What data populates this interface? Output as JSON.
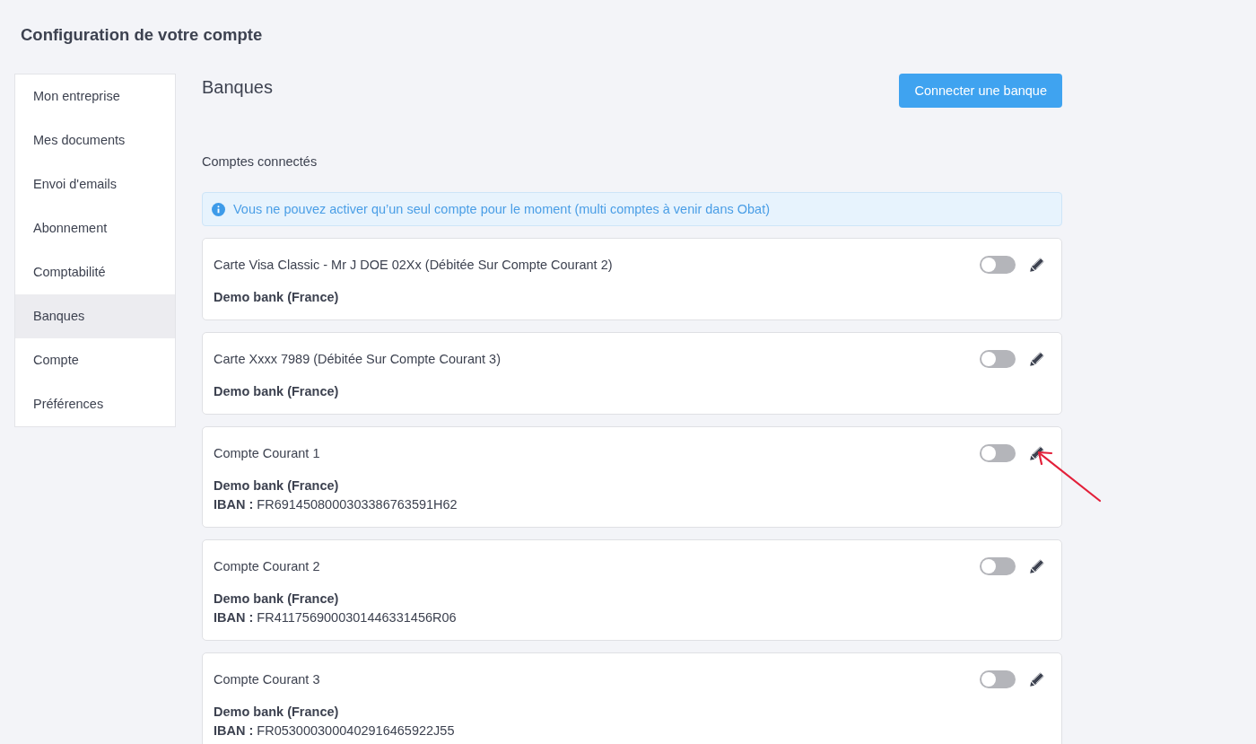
{
  "page_title": "Configuration de votre compte",
  "sidebar": {
    "items": [
      {
        "label": "Mon entreprise",
        "selected": false
      },
      {
        "label": "Mes documents",
        "selected": false
      },
      {
        "label": "Envoi d'emails",
        "selected": false
      },
      {
        "label": "Abonnement",
        "selected": false
      },
      {
        "label": "Comptabilité",
        "selected": false
      },
      {
        "label": "Banques",
        "selected": true
      },
      {
        "label": "Compte",
        "selected": false
      },
      {
        "label": "Préférences",
        "selected": false
      }
    ]
  },
  "section": {
    "title": "Banques",
    "connect_button": "Connecter une banque",
    "subtitle": "Comptes connectés",
    "info": "Vous ne pouvez activer qu’un seul compte pour le moment (multi comptes à venir dans Obat)"
  },
  "accounts": [
    {
      "name": "Carte Visa Classic - Mr J DOE 02Xx (Débitée Sur Compte Courant 2)",
      "bank": "Demo bank (France)",
      "enabled": false
    },
    {
      "name": "Carte Xxxx 7989 (Débitée Sur Compte Courant 3)",
      "bank": "Demo bank (France)",
      "enabled": false
    },
    {
      "name": "Compte Courant 1",
      "bank": "Demo bank (France)",
      "iban_label": "IBAN :",
      "iban": "FR6914508000303386763591H62",
      "enabled": false
    },
    {
      "name": "Compte Courant 2",
      "bank": "Demo bank (France)",
      "iban_label": "IBAN :",
      "iban": "FR4117569000301446331456R06",
      "enabled": false
    },
    {
      "name": "Compte Courant 3",
      "bank": "Demo bank (France)",
      "iban_label": "IBAN :",
      "iban": "FR0530003000402916465922J55",
      "enabled": false
    }
  ]
}
